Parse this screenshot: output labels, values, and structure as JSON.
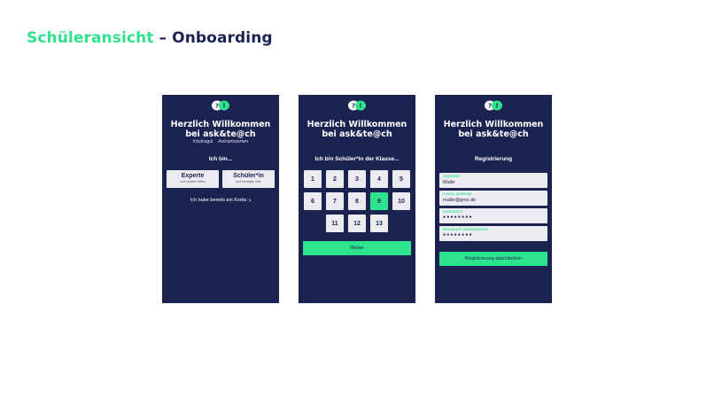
{
  "page": {
    "title_accent": "Schüleransicht",
    "title_rest": "– Onboarding"
  },
  "colors": {
    "navy": "#1b2350",
    "green": "#2ee38e",
    "button_light": "#ebebf0"
  },
  "welcome": {
    "line1": "Herzlich Willkommen",
    "line2": "bei ask&te@ch"
  },
  "screen1": {
    "tags": [
      "#dufragst",
      "#wirantworten"
    ],
    "prompt": "Ich bin...",
    "expert": {
      "title": "Experte",
      "subtitle": "und möchte helfen"
    },
    "student": {
      "title": "Schüler*in",
      "subtitle": "und benötige Hilfe"
    },
    "login_link": "Ich habe bereits ein Konto",
    "login_icon": "chevron-right-icon"
  },
  "screen2": {
    "prompt": "Ich bin Schüler*in der Klasse...",
    "grades": [
      "1",
      "2",
      "3",
      "4",
      "5",
      "6",
      "7",
      "8",
      "9",
      "10",
      "11",
      "12",
      "13"
    ],
    "selected_grade": "9",
    "next_button": "Weiter"
  },
  "screen3": {
    "heading": "Registrierung",
    "fields": [
      {
        "label": "VORNAME",
        "value": "Malte"
      },
      {
        "label": "E-MAIL-ADRESSE",
        "value": "malte@gmx.de"
      },
      {
        "label": "PASSWORT",
        "value": "●●●●●●●●"
      },
      {
        "label": "PASSWORT WIEDERHOLEN",
        "value": "●●●●●●●●"
      }
    ],
    "submit_button": "Registrierung abschließen"
  },
  "logo_icon": "speech-bubbles-logo-icon"
}
